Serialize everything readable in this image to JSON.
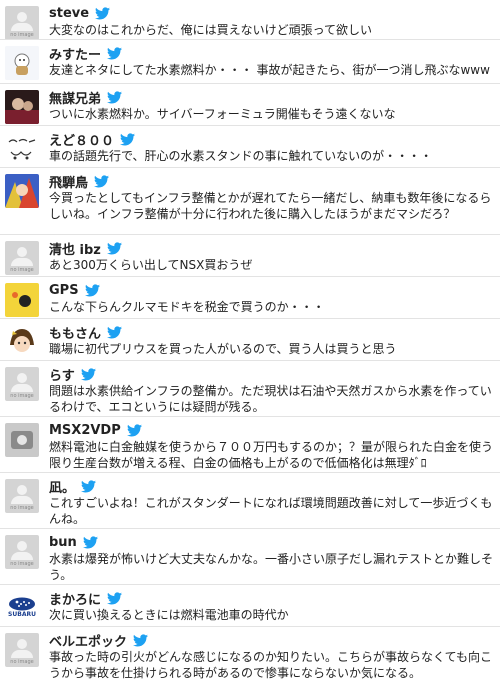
{
  "colors": {
    "bird": "#1da1f2",
    "divider": "#e3e3e3",
    "noimage_bg": "#d4d4d4"
  },
  "no_image_label": "no image",
  "feed": [
    {
      "name": "steve",
      "avatar": "no-image",
      "text": "大変なのはこれからだ、俺には買えないけど頑張って欲しい"
    },
    {
      "name": "みすたー",
      "avatar": "cartoon-avatar",
      "text": "友達とネタにしてた水素燃料か・・・ 事故が起きたら、街が一つ消し飛ぶなwww"
    },
    {
      "name": "無謀兄弟",
      "avatar": "photo-avatar",
      "text": "ついに水素燃料か。サイバーフォーミュラ開催もそう遠くないな"
    },
    {
      "name": "えど８００",
      "avatar": "sketch-avatar",
      "text": "車の話題先行で、肝心の水素スタンドの事に触れていないのが・・・・"
    },
    {
      "name": "飛騨鳥",
      "avatar": "anime-avatar",
      "text": "今買ったとしてもインフラ整備とかが遅れてたら一緒だし、納車も数年後になるらしいね。インフラ整備が十分に行われた後に購入したほうがまだマシだろ？"
    },
    {
      "name": "清也 ibz",
      "avatar": "no-image",
      "text": "あと300万くらい出してNSX買おうぜ"
    },
    {
      "name": "GPS",
      "avatar": "yellow-avatar",
      "text": "こんな下らんクルマモドキを税金で買うのか・・・"
    },
    {
      "name": "ももさん",
      "avatar": "girl-avatar",
      "text": "職場に初代プリウスを買った人がいるので、買う人は買うと思う"
    },
    {
      "name": "らす",
      "avatar": "no-image",
      "text": "問題は水素供給インフラの整備か。ただ現状は石油や天然ガスから水素を作っているわけで、エコというには疑問が残る。"
    },
    {
      "name": "MSX2VDP",
      "avatar": "gray-photo-avatar",
      "text": "燃料電池に白金触媒を使うから７００万円もするのか；？量が限られた白金を使う限り生産台数が増える程、白金の価格も上がるので低価格化は無理ﾀﾞﾛ"
    },
    {
      "name": "凪。",
      "avatar": "no-image",
      "text": "これすごいよね！これがスタンダートになれば環境問題改善に対して一歩近づくもんね。"
    },
    {
      "name": "bun",
      "avatar": "no-image",
      "text": "水素は爆発が怖いけど大丈夫なんかな。一番小さい原子だし漏れテストとか難しそう。"
    },
    {
      "name": "まかろに",
      "avatar": "subaru-logo",
      "logo_text": "SUBARU",
      "text": "次に買い換えるときには燃料電池車の時代か"
    },
    {
      "name": "ベルエポック",
      "avatar": "no-image",
      "text": "事故った時の引火がどんな感じになるのか知りたい。こちらが事故らなくても向こうから事故を仕掛けられる時があるので惨事にならないか気になる。"
    }
  ]
}
